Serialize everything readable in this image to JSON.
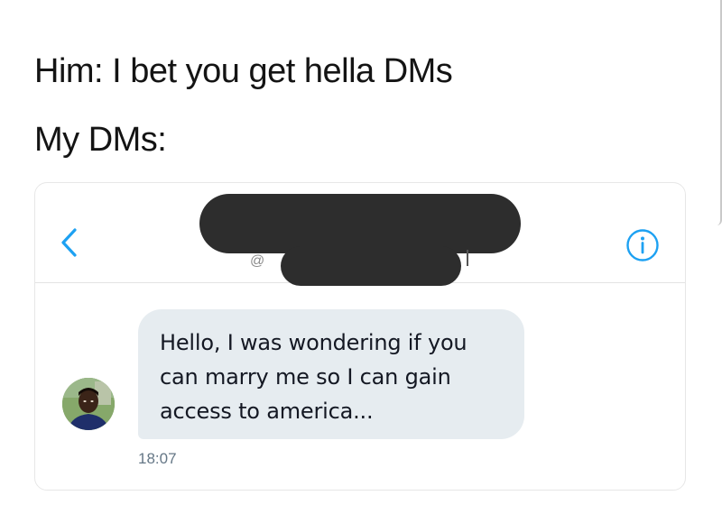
{
  "caption": {
    "line1": "Him: I bet you get hella DMs",
    "line2": "My DMs:"
  },
  "conversation": {
    "handle_prefix": "@",
    "message": {
      "line1": "Hello, I was wondering if you",
      "line2": "can marry me so I can gain",
      "line3": "access to america...",
      "timestamp": "18:07"
    }
  },
  "icons": {
    "back": "chevron-left-icon",
    "info": "info-circle-icon"
  },
  "colors": {
    "accent": "#1da1f2",
    "bubble": "#e6ecf0",
    "redaction": "#2d2d2d",
    "timestamp": "#657786"
  }
}
